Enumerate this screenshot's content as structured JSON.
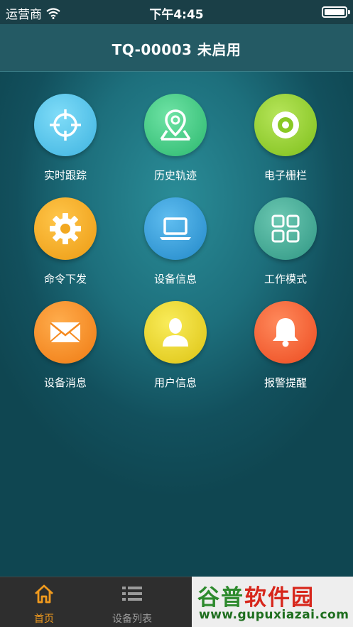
{
  "status_bar": {
    "carrier": "运营商",
    "time": "下午4:45"
  },
  "nav": {
    "title": "TQ-00003 未启用"
  },
  "menu": [
    {
      "label": "实时跟踪",
      "icon": "crosshair-icon",
      "color": "#4bbde6"
    },
    {
      "label": "历史轨迹",
      "icon": "map-pin-icon",
      "color": "#34c37c"
    },
    {
      "label": "电子栅栏",
      "icon": "disc-icon",
      "color": "#8ac924"
    },
    {
      "label": "命令下发",
      "icon": "gear-icon",
      "color": "#f2a821"
    },
    {
      "label": "设备信息",
      "icon": "laptop-icon",
      "color": "#2e97d6"
    },
    {
      "label": "工作模式",
      "icon": "grid-icon",
      "color": "#3fa892"
    },
    {
      "label": "设备消息",
      "icon": "envelope-icon",
      "color": "#f58a1f"
    },
    {
      "label": "用户信息",
      "icon": "user-icon",
      "color": "#e8d21c"
    },
    {
      "label": "报警提醒",
      "icon": "bell-icon",
      "color": "#f2572d"
    }
  ],
  "tabs": [
    {
      "label": "首页",
      "icon": "home-icon",
      "active": true,
      "color": "#f09a1e"
    },
    {
      "label": "设备列表",
      "icon": "list-icon",
      "active": false,
      "color": "#9a9a9a"
    }
  ],
  "watermark": {
    "title_green": "谷普",
    "title_red": "软件园",
    "url": "www.gupuxiazai.com"
  }
}
